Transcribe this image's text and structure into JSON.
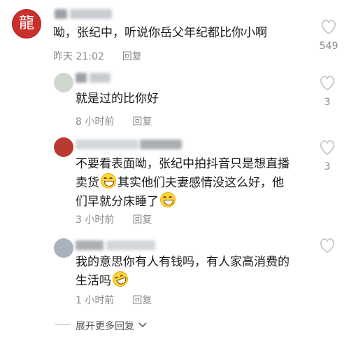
{
  "comments": [
    {
      "text": "呦，张纪中，听说你岳父年纪都比你小啊",
      "time": "昨天 21:02",
      "reply_label": "回复",
      "likes": "549"
    },
    {
      "text": "就是过的比你好",
      "time": "8 小时前",
      "reply_label": "回复",
      "likes": "3"
    },
    {
      "text_line1": "不要看表面呦，张纪中拍抖音只是想直播",
      "text_line2a": "卖货",
      "text_line2b": "其实他们夫妻感情没这么好，他",
      "text_line3": "们早就分床睡了",
      "time": "3 小时前",
      "reply_label": "回复",
      "likes": "3"
    },
    {
      "text_line1": "我的意思你有人有钱吗，有人家高消费的",
      "text_line2": "生活吗",
      "time": "1 小时前",
      "reply_label": "回复",
      "likes": ""
    }
  ],
  "expand_label": "展开更多回复",
  "icons": {
    "like": "heart-outline-icon",
    "grin": "grinning-emoji",
    "laugh": "rolling-laughing-emoji",
    "chevron": "chevron-down-icon"
  }
}
